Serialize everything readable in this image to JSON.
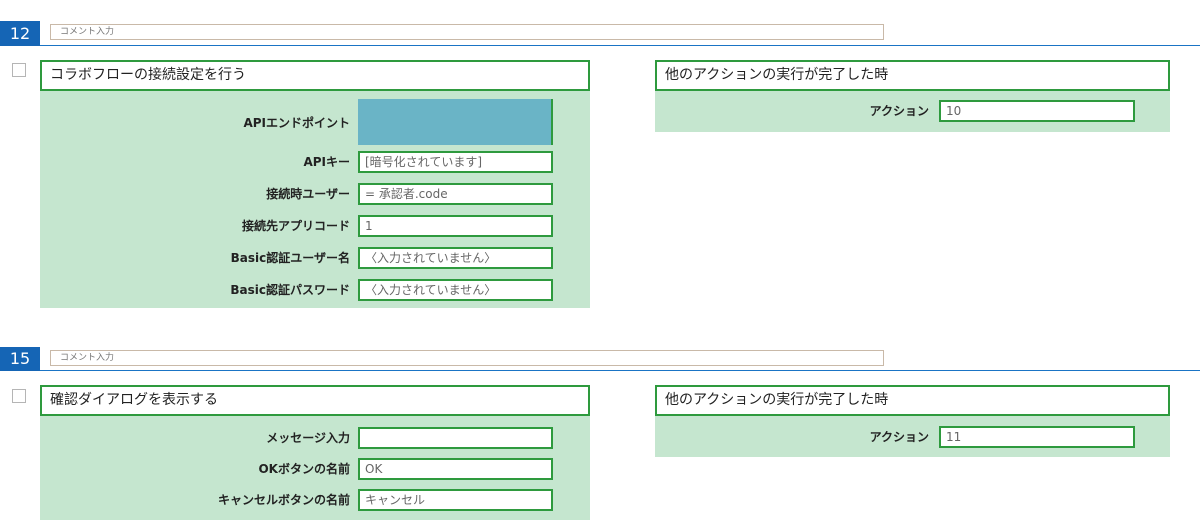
{
  "blocks": [
    {
      "number": "12",
      "comment_placeholder": "コメント入力",
      "left": {
        "title": "コラボフローの接続設定を行う",
        "rows": [
          {
            "label": "APIエンドポイント",
            "value": ""
          },
          {
            "label": "APIキー",
            "value": "[暗号化されています]"
          },
          {
            "label": "接続時ユーザー",
            "value": "= 承認者.code"
          },
          {
            "label": "接続先アプリコード",
            "value": "1"
          },
          {
            "label": "Basic認証ユーザー名",
            "value": "〈入力されていません〉"
          },
          {
            "label": "Basic認証パスワード",
            "value": "〈入力されていません〉"
          }
        ]
      },
      "right": {
        "title": "他のアクションの実行が完了した時",
        "label": "アクション",
        "value": "10"
      }
    },
    {
      "number": "15",
      "comment_placeholder": "コメント入力",
      "left": {
        "title": "確認ダイアログを表示する",
        "rows": [
          {
            "label": "メッセージ入力",
            "value": ""
          },
          {
            "label": "OKボタンの名前",
            "value": "OK"
          },
          {
            "label": "キャンセルボタンの名前",
            "value": "キャンセル"
          }
        ]
      },
      "right": {
        "title": "他のアクションの実行が完了した時",
        "label": "アクション",
        "value": "11"
      }
    }
  ],
  "colors": {
    "accent_blue": "#1565b5",
    "panel_green": "#c5e6cf",
    "field_border": "#2e9a3e",
    "endpoint_fill": "#6ab4c6"
  }
}
